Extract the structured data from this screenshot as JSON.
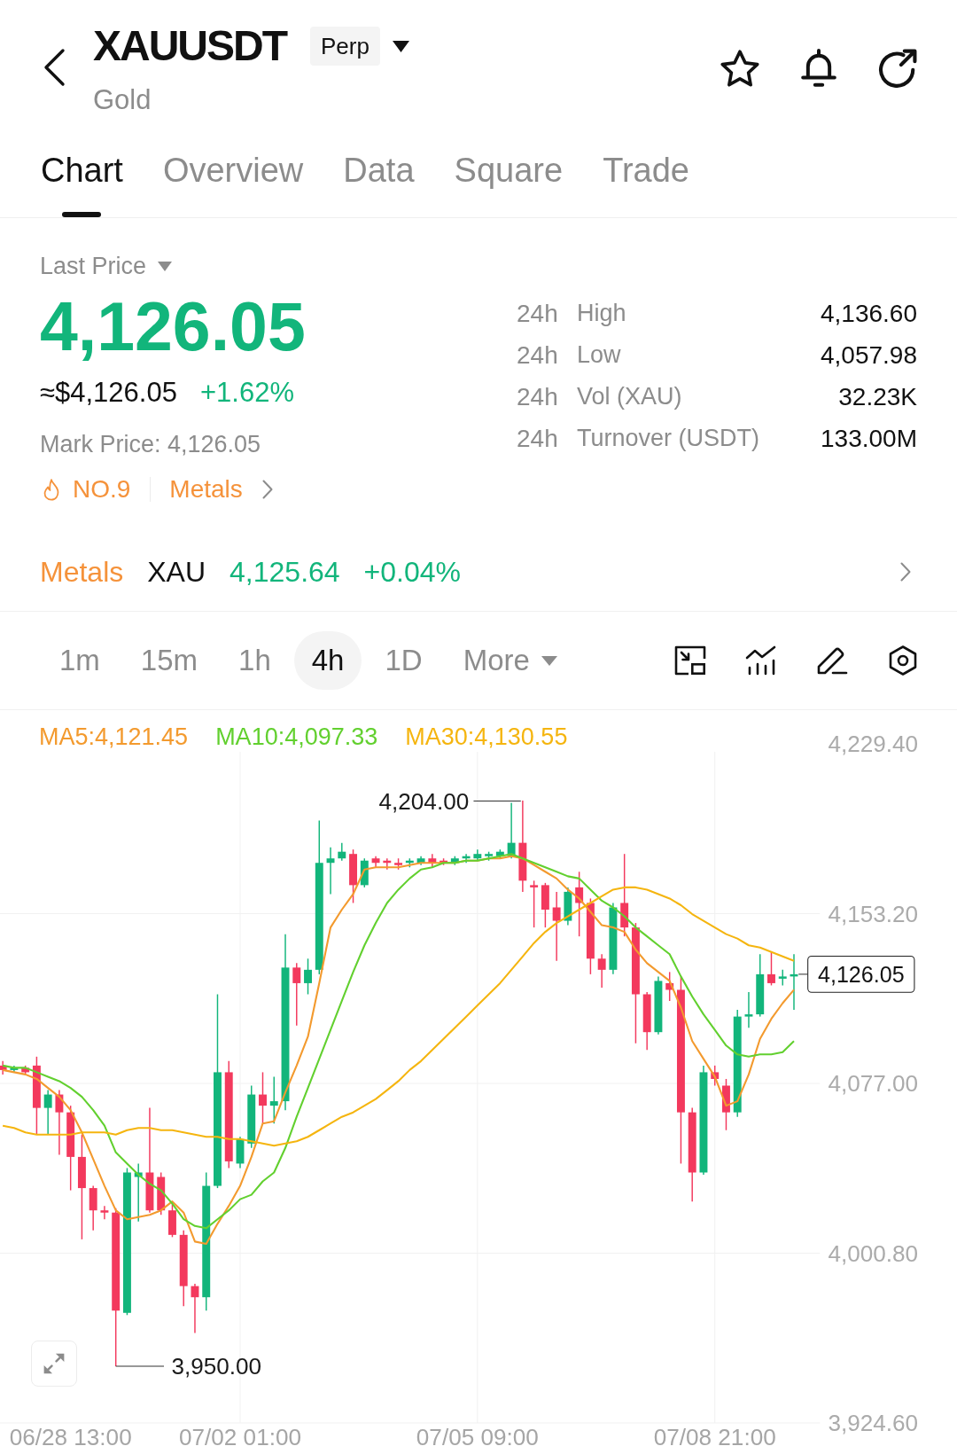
{
  "header": {
    "symbol": "XAUUSDT",
    "contract_type": "Perp",
    "name": "Gold"
  },
  "tabs": [
    {
      "label": "Chart",
      "selected": true
    },
    {
      "label": "Overview",
      "selected": false
    },
    {
      "label": "Data",
      "selected": false
    },
    {
      "label": "Square",
      "selected": false
    },
    {
      "label": "Trade",
      "selected": false
    }
  ],
  "price": {
    "label": "Last Price",
    "last_price": "4,126.05",
    "usd_value": "≈$4,126.05",
    "change": "+1.62%",
    "mark_price": "Mark Price: 4,126.05",
    "rank": "NO.9",
    "sector": "Metals"
  },
  "stats": [
    {
      "period": "24h",
      "label": "High",
      "value": "4,136.60"
    },
    {
      "period": "24h",
      "label": "Low",
      "value": "4,057.98"
    },
    {
      "period": "24h",
      "label": "Vol (XAU)",
      "value": "32.23K"
    },
    {
      "period": "24h",
      "label": "Turnover (USDT)",
      "value": "133.00M"
    }
  ],
  "index": {
    "sector": "Metals",
    "symbol": "XAU",
    "price": "4,125.64",
    "change": "+0.04%"
  },
  "intervals": [
    {
      "label": "1m",
      "selected": false,
      "kind": "interval"
    },
    {
      "label": "15m",
      "selected": false,
      "kind": "interval"
    },
    {
      "label": "1h",
      "selected": false,
      "kind": "interval"
    },
    {
      "label": "4h",
      "selected": true,
      "kind": "interval"
    },
    {
      "label": "1D",
      "selected": false,
      "kind": "interval"
    },
    {
      "label": "More",
      "selected": false,
      "kind": "menu"
    }
  ],
  "chart": {
    "high_label": "4,204.00",
    "low_label": "3,950.00",
    "last_price_tag": "4,126.05",
    "chart_data": {
      "type": "candlestick",
      "grid": true,
      "categories": [
        null,
        null,
        null,
        null,
        null,
        null,
        "06/28 13:00",
        null,
        null,
        null,
        null,
        null,
        null,
        null,
        null,
        null,
        null,
        null,
        null,
        null,
        null,
        "07/02 01:00",
        null,
        null,
        null,
        null,
        null,
        null,
        null,
        null,
        null,
        null,
        null,
        null,
        null,
        null,
        null,
        null,
        null,
        null,
        null,
        null,
        "07/05 09:00",
        null,
        null,
        null,
        null,
        null,
        null,
        null,
        null,
        null,
        null,
        null,
        null,
        null,
        null,
        null,
        null,
        null,
        null,
        null,
        null,
        "07/08 21:00",
        null,
        null,
        null,
        null,
        null,
        null,
        null
      ],
      "ohlc": [
        [
          4085,
          4087,
          4081,
          4083
        ],
        [
          4083,
          4085,
          4082,
          4084
        ],
        [
          4084,
          4085,
          4081,
          4082
        ],
        [
          4085,
          4089,
          4054,
          4066
        ],
        [
          4066,
          4074,
          4054,
          4072
        ],
        [
          4072,
          4074,
          4045,
          4064
        ],
        [
          4064,
          4067,
          4029,
          4044
        ],
        [
          4044,
          4054,
          4007,
          4030
        ],
        [
          4030,
          4031,
          4011,
          4020
        ],
        [
          4020,
          4022,
          4016,
          4019
        ],
        [
          4019,
          4021,
          3950,
          3975
        ],
        [
          3974,
          4039,
          3973,
          4037
        ],
        [
          4035,
          4041,
          4015,
          4037
        ],
        [
          4037,
          4066,
          4019,
          4020
        ],
        [
          4035,
          4037,
          4018,
          4020
        ],
        [
          4020,
          4023,
          4008,
          4009
        ],
        [
          4009,
          4011,
          3977,
          3986
        ],
        [
          3986,
          3987,
          3965,
          3981
        ],
        [
          3981,
          4037,
          3975,
          4031
        ],
        [
          4031,
          4117,
          4030,
          4082
        ],
        [
          4082,
          4087,
          4039,
          4042
        ],
        [
          4041,
          4053,
          4039,
          4052
        ],
        [
          4050,
          4076,
          4048,
          4072
        ],
        [
          4072,
          4082,
          4059,
          4067
        ],
        [
          4067,
          4080,
          4059,
          4069
        ],
        [
          4069,
          4144,
          4065,
          4129
        ],
        [
          4129,
          4131,
          4103,
          4122
        ],
        [
          4122,
          4133,
          4117,
          4128
        ],
        [
          4128,
          4195,
          4126,
          4176
        ],
        [
          4176,
          4183,
          4162,
          4178
        ],
        [
          4178,
          4185,
          4177,
          4181
        ],
        [
          4180,
          4182,
          4158,
          4166
        ],
        [
          4166,
          4178,
          4165,
          4177
        ],
        [
          4178,
          4179,
          4174,
          4176
        ],
        [
          4177,
          4178,
          4173,
          4176
        ],
        [
          4176,
          4178,
          4173,
          4175
        ],
        [
          4176,
          4178,
          4174,
          4177
        ],
        [
          4176,
          4179,
          4175,
          4178
        ],
        [
          4178,
          4180,
          4174,
          4176
        ],
        [
          4177,
          4178,
          4175,
          4176
        ],
        [
          4176,
          4179,
          4175,
          4178
        ],
        [
          4178,
          4180,
          4176,
          4179
        ],
        [
          4178,
          4182,
          4177,
          4180
        ],
        [
          4179,
          4181,
          4177,
          4180
        ],
        [
          4179,
          4182,
          4178,
          4181
        ],
        [
          4179,
          4203,
          4178,
          4185
        ],
        [
          4185,
          4204,
          4163,
          4168
        ],
        [
          4166,
          4168,
          4147,
          4165
        ],
        [
          4166,
          4167,
          4147,
          4155
        ],
        [
          4156,
          4163,
          4132,
          4150
        ],
        [
          4150,
          4165,
          4148,
          4163
        ],
        [
          4165,
          4172,
          4143,
          4158
        ],
        [
          4158,
          4160,
          4126,
          4133
        ],
        [
          4133,
          4135,
          4120,
          4128
        ],
        [
          4128,
          4158,
          4126,
          4156
        ],
        [
          4158,
          4180,
          4143,
          4147
        ],
        [
          4147,
          4149,
          4095,
          4117
        ],
        [
          4117,
          4118,
          4092,
          4100
        ],
        [
          4100,
          4125,
          4099,
          4123
        ],
        [
          4122,
          4127,
          4114,
          4119
        ],
        [
          4119,
          4125,
          4041,
          4064
        ],
        [
          4064,
          4066,
          4024,
          4037
        ],
        [
          4037,
          4085,
          4036,
          4082
        ],
        [
          4082,
          4085,
          4076,
          4079
        ],
        [
          4076,
          4079,
          4056,
          4064
        ],
        [
          4064,
          4110,
          4062,
          4107
        ],
        [
          4107,
          4118,
          4102,
          4108
        ],
        [
          4108,
          4135,
          4107,
          4126
        ],
        [
          4126,
          4136,
          4121,
          4122
        ],
        [
          4124,
          4128,
          4121,
          4125
        ],
        [
          4125,
          4135,
          4110,
          4126
        ]
      ],
      "series": [
        {
          "name": "MA5:4,121.45",
          "type": "line",
          "color": "#f39a2e",
          "values": [
            4083,
            4082,
            4081,
            4079,
            4075,
            4071,
            4065,
            4055,
            4043,
            4031,
            4020,
            4016,
            4017,
            4018,
            4020,
            4024,
            4019,
            4006,
            4005,
            4014,
            4022,
            4031,
            4044,
            4059,
            4060,
            4073,
            4085,
            4098,
            4122,
            4147,
            4155,
            4162,
            4173,
            4174,
            4174,
            4174,
            4175,
            4176,
            4176,
            4176,
            4176,
            4177,
            4177,
            4178,
            4178,
            4179,
            4178,
            4175,
            4172,
            4169,
            4164,
            4160,
            4154,
            4148,
            4147,
            4145,
            4137,
            4131,
            4127,
            4123,
            4111,
            4096,
            4088,
            4080,
            4067,
            4069,
            4081,
            4097,
            4106,
            4113,
            4119
          ]
        },
        {
          "name": "MA10:4,097.33",
          "type": "line",
          "color": "#62d02f",
          "values": [
            4085,
            4084,
            4084,
            4082,
            4080,
            4078,
            4075,
            4071,
            4065,
            4058,
            4046,
            4041,
            4036,
            4032,
            4029,
            4023,
            4016,
            4013,
            4012,
            4016,
            4020,
            4025,
            4027,
            4033,
            4037,
            4048,
            4062,
            4075,
            4088,
            4101,
            4114,
            4127,
            4139,
            4149,
            4158,
            4164,
            4169,
            4173,
            4174,
            4176,
            4176,
            4177,
            4177,
            4178,
            4179,
            4180,
            4178,
            4176,
            4174,
            4172,
            4170,
            4169,
            4164,
            4159,
            4156,
            4152,
            4147,
            4143,
            4139,
            4135,
            4125,
            4116,
            4108,
            4101,
            4094,
            4090,
            4089,
            4090,
            4090,
            4091,
            4096
          ]
        },
        {
          "name": "MA30:4,130.55",
          "type": "line",
          "color": "#f5b50f",
          "values": [
            4058,
            4057,
            4055,
            4054,
            4054,
            4054,
            4054,
            4055,
            4055,
            4055,
            4054,
            4056,
            4057,
            4057,
            4056,
            4056,
            4055,
            4054,
            4053,
            4053,
            4052,
            4052,
            4051,
            4050,
            4049,
            4050,
            4051,
            4053,
            4056,
            4059,
            4062,
            4064,
            4067,
            4070,
            4074,
            4078,
            4083,
            4087,
            4092,
            4097,
            4102,
            4107,
            4112,
            4117,
            4122,
            4128,
            4134,
            4140,
            4145,
            4149,
            4152,
            4155,
            4158,
            4161,
            4164,
            4165,
            4165,
            4164,
            4162,
            4160,
            4157,
            4153,
            4150,
            4147,
            4144,
            4142,
            4139,
            4138,
            4136,
            4134,
            4132
          ]
        }
      ],
      "ylim": [
        3924.6,
        4229.4
      ],
      "yticks": [
        {
          "value": 4229.4,
          "label": "4,229.40"
        },
        {
          "value": 4153.2,
          "label": "4,153.20"
        },
        {
          "value": 4077.0,
          "label": "4,077.00"
        },
        {
          "value": 4000.8,
          "label": "4,000.80"
        },
        {
          "value": 3924.6,
          "label": "3,924.60"
        }
      ]
    }
  }
}
